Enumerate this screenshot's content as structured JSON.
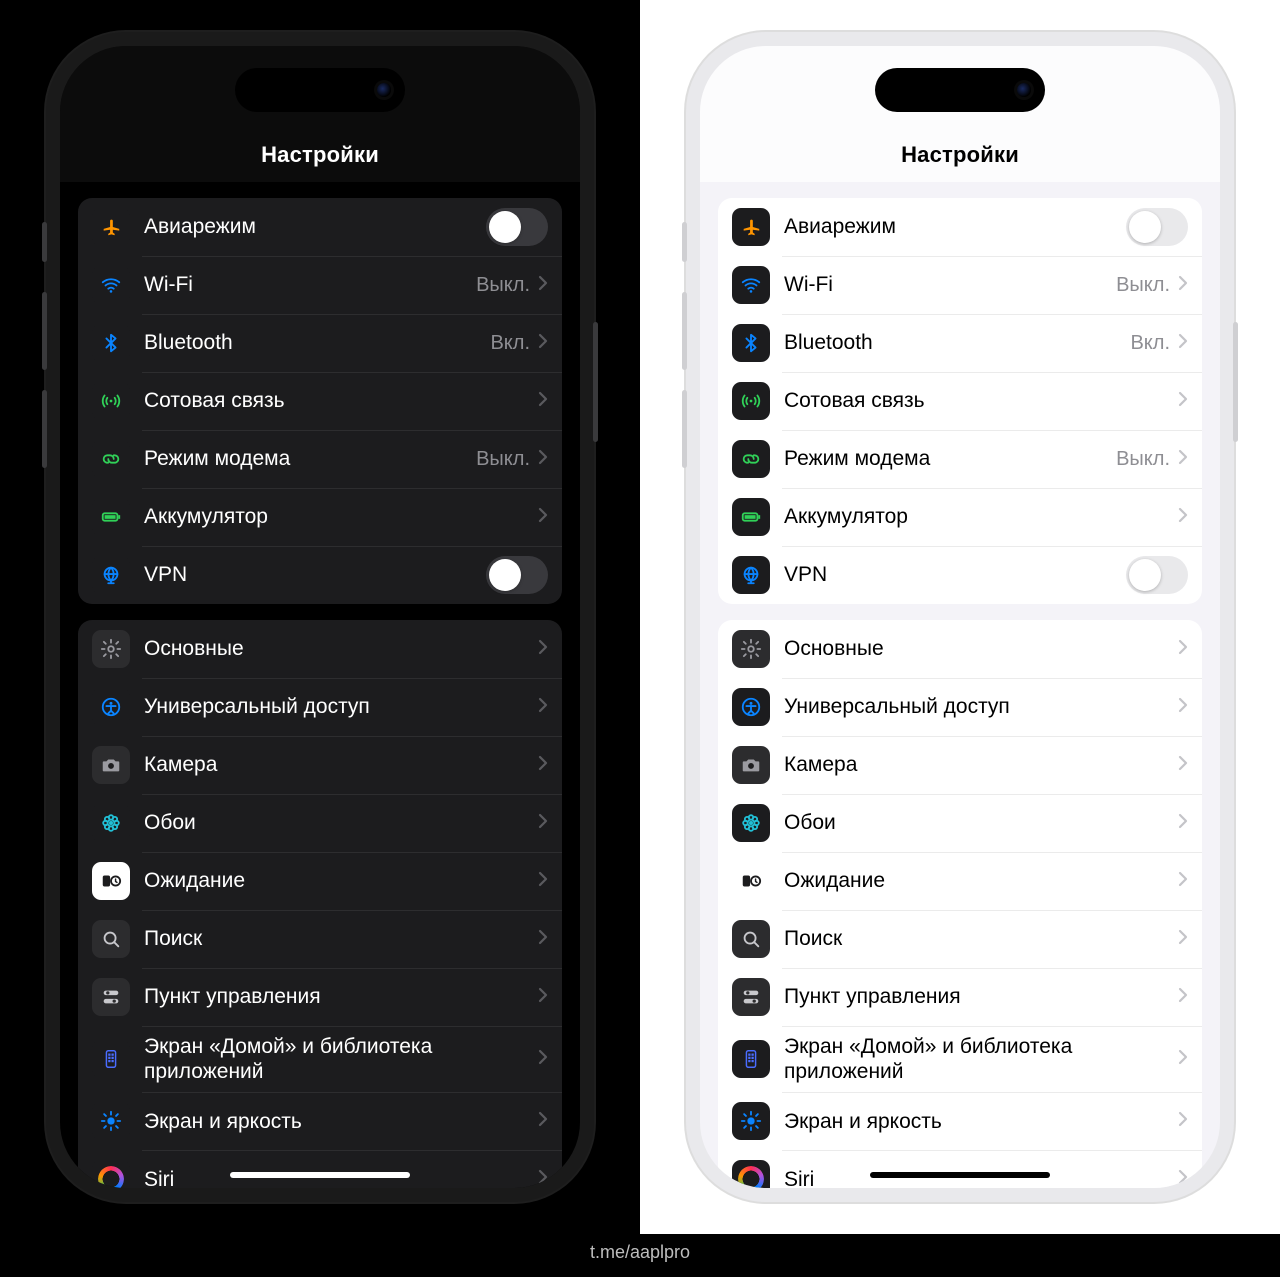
{
  "title": "Настройки",
  "caption": "t.me/aaplpro",
  "groups": [
    {
      "rows": [
        {
          "id": "airplane",
          "label": "Авиарежим",
          "control": "toggle",
          "on": false
        },
        {
          "id": "wifi",
          "label": "Wi-Fi",
          "control": "drill",
          "value": "Выкл."
        },
        {
          "id": "bluetooth",
          "label": "Bluetooth",
          "control": "drill",
          "value": "Вкл."
        },
        {
          "id": "cellular",
          "label": "Сотовая связь",
          "control": "drill"
        },
        {
          "id": "hotspot",
          "label": "Режим модема",
          "control": "drill",
          "value": "Выкл."
        },
        {
          "id": "battery",
          "label": "Аккумулятор",
          "control": "drill"
        },
        {
          "id": "vpn",
          "label": "VPN",
          "control": "toggle",
          "on": false
        }
      ]
    },
    {
      "rows": [
        {
          "id": "general",
          "label": "Основные",
          "control": "drill"
        },
        {
          "id": "accessibility",
          "label": "Универсальный доступ",
          "control": "drill"
        },
        {
          "id": "camera",
          "label": "Камера",
          "control": "drill"
        },
        {
          "id": "wallpaper",
          "label": "Обои",
          "control": "drill"
        },
        {
          "id": "standby",
          "label": "Ожидание",
          "control": "drill"
        },
        {
          "id": "search",
          "label": "Поиск",
          "control": "drill"
        },
        {
          "id": "controlcenter",
          "label": "Пункт управления",
          "control": "drill"
        },
        {
          "id": "homescreen",
          "label": "Экран «Домой» и библиотека приложений",
          "control": "drill"
        },
        {
          "id": "display",
          "label": "Экран и яркость",
          "control": "drill"
        },
        {
          "id": "siri",
          "label": "Siri",
          "control": "drill"
        }
      ]
    }
  ],
  "icons": {
    "airplane": {
      "bg": "#1c1c1e",
      "svg": "plane",
      "fg": "#ff9500"
    },
    "wifi": {
      "bg": "#1c1c1e",
      "svg": "wifi",
      "fg": "#0a84ff"
    },
    "bluetooth": {
      "bg": "#1c1c1e",
      "svg": "bt",
      "fg": "#0a84ff"
    },
    "cellular": {
      "bg": "#1c1c1e",
      "svg": "cell",
      "fg": "#30d158"
    },
    "hotspot": {
      "bg": "#1c1c1e",
      "svg": "link",
      "fg": "#30d158"
    },
    "battery": {
      "bg": "#1c1c1e",
      "svg": "batt",
      "fg": "#30d158"
    },
    "vpn": {
      "bg": "#1c1c1e",
      "svg": "globe",
      "fg": "#0a84ff"
    },
    "general": {
      "bg": "#2c2c2e",
      "svg": "gear",
      "fg": "#9a9aa0"
    },
    "accessibility": {
      "bg": "#1c1c1e",
      "svg": "acc",
      "fg": "#0a84ff"
    },
    "camera": {
      "bg": "#2c2c2e",
      "svg": "cam",
      "fg": "#9a9aa0"
    },
    "wallpaper": {
      "bg": "#1c1c1e",
      "svg": "flower",
      "fg": "#22c0d6"
    },
    "standby": {
      "bg": "#ffffff",
      "svg": "clock",
      "fg": "#1c1c1e"
    },
    "search": {
      "bg": "#2c2c2e",
      "svg": "mag",
      "fg": "#c8c8cc"
    },
    "controlcenter": {
      "bg": "#2c2c2e",
      "svg": "cc",
      "fg": "#c8c8cc"
    },
    "homescreen": {
      "bg": "#1c1c1e",
      "svg": "hs",
      "fg": "#4a6cff"
    },
    "display": {
      "bg": "#1c1c1e",
      "svg": "sun",
      "fg": "#0a84ff"
    },
    "siri": {
      "bg": "#1c1c1e",
      "svg": "siri",
      "fg": ""
    }
  }
}
